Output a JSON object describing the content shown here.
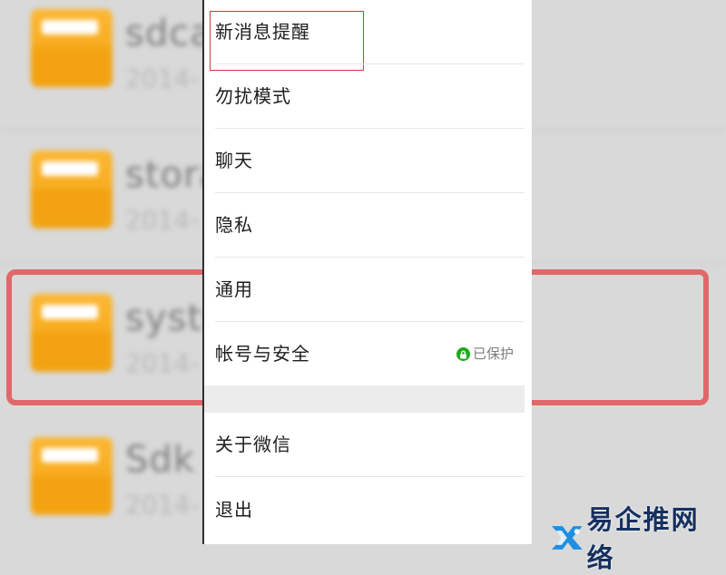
{
  "background": {
    "files": [
      {
        "name": "sdcard",
        "date": "2014-"
      },
      {
        "name": "storage",
        "date": "2014-"
      },
      {
        "name": "system",
        "date": "2014-"
      },
      {
        "name": "Sdk",
        "date": "2014-"
      }
    ]
  },
  "settings": {
    "items": [
      {
        "label": "新消息提醒"
      },
      {
        "label": "勿扰模式"
      },
      {
        "label": "聊天"
      },
      {
        "label": "隐私"
      },
      {
        "label": "通用"
      },
      {
        "label": "帐号与安全",
        "status": "已保护"
      },
      {
        "label": "关于微信"
      },
      {
        "label": "退出"
      }
    ],
    "status_icon": "lock-icon",
    "status_color": "#1aad19"
  },
  "watermark": {
    "text": "易企推网络",
    "logo_icon": "watermark-logo-icon"
  },
  "colors": {
    "highlight_red": "#e0333a",
    "folder_orange": "#f5a10a"
  }
}
